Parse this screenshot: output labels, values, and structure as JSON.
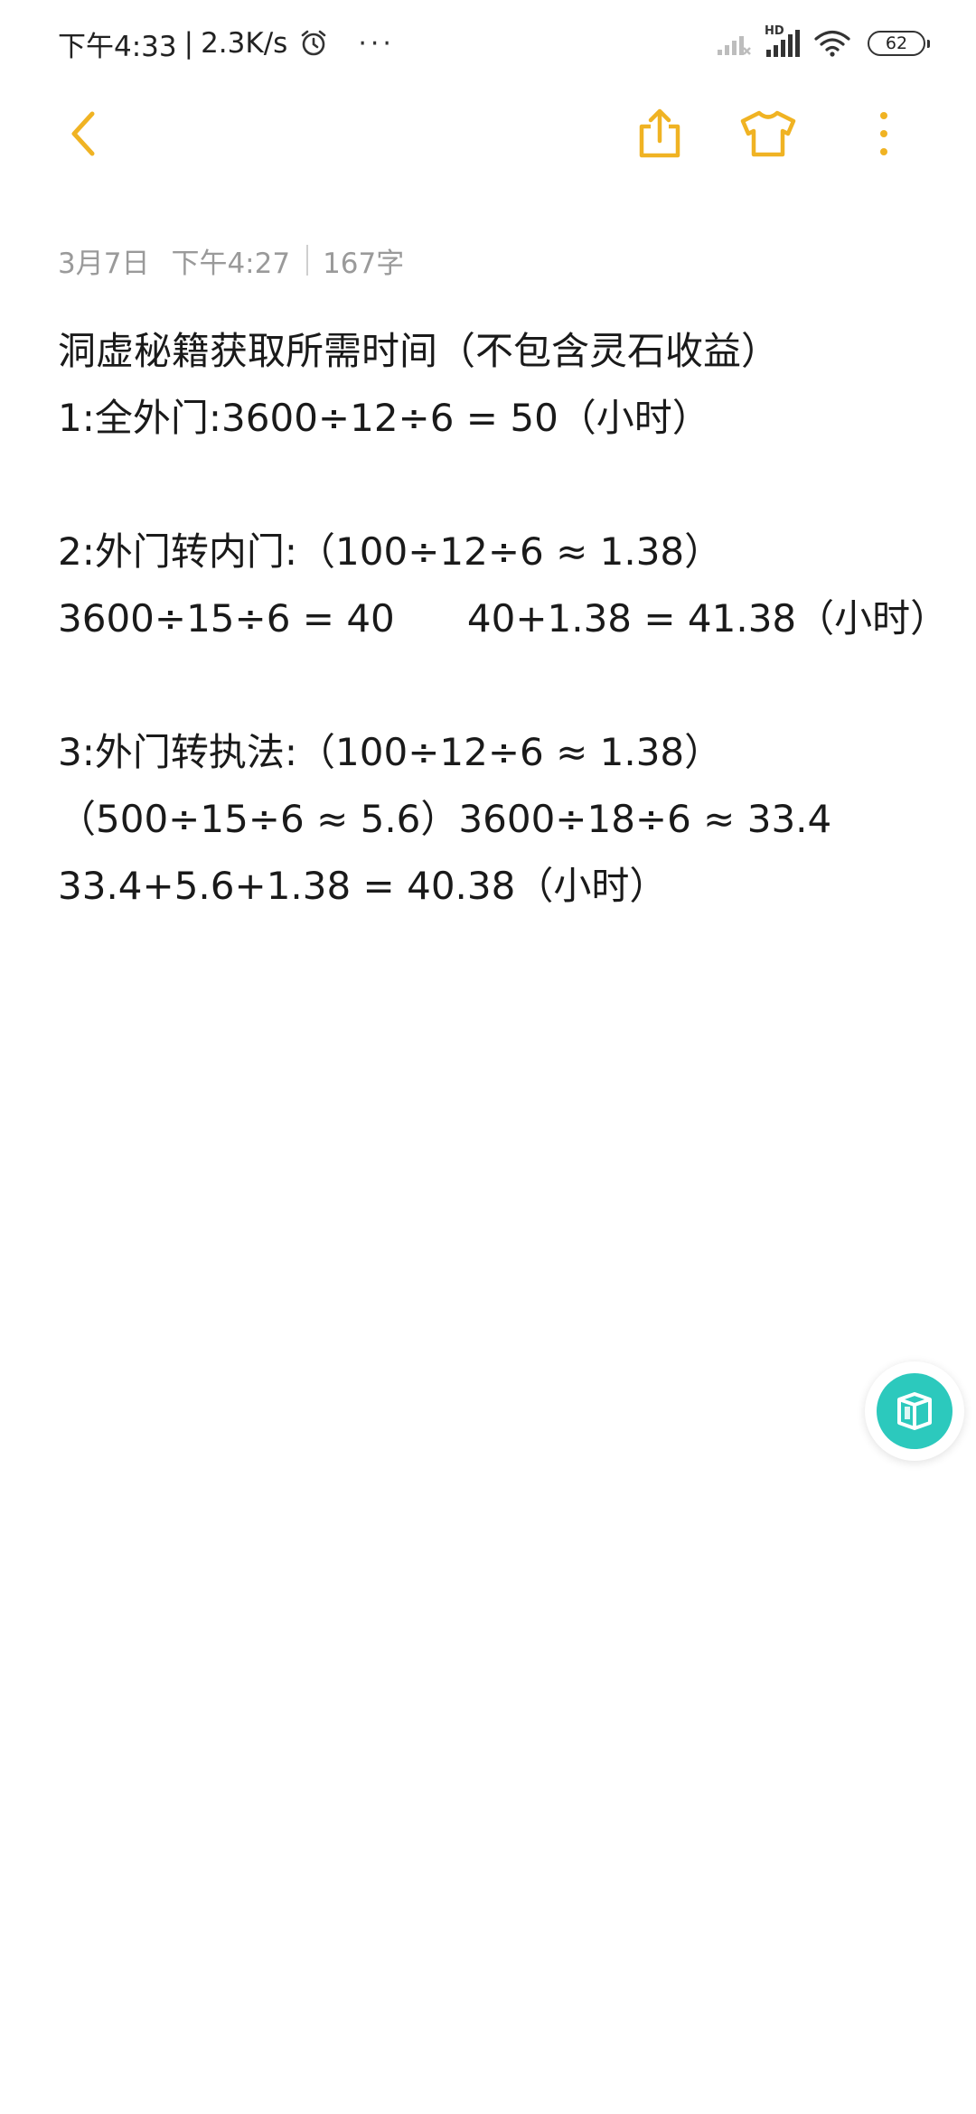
{
  "status_bar": {
    "time": "下午4:33",
    "separator": "|",
    "net_speed": "2.3K/s",
    "more_glyph": "···",
    "network_label": "HD",
    "battery_level": "62",
    "icons": [
      "alarm-icon",
      "signal-weak-icon",
      "signal-hd-icon",
      "wifi-icon",
      "battery-icon"
    ]
  },
  "toolbar": {
    "accent_color": "#f0b323",
    "icons": [
      "back-icon",
      "share-icon",
      "theme-shirt-icon",
      "more-vertical-icon"
    ]
  },
  "meta": {
    "date": "3月7日",
    "time": "下午4:27",
    "word_count": "167字"
  },
  "note": {
    "lines": [
      "洞虚秘籍获取所需时间（不包含灵石收益）",
      "1:全外门:3600÷12÷6 = 50（小时）",
      "",
      "2:外门转内门:（100÷12÷6 ≈ 1.38）",
      "3600÷15÷6 = 40      40+1.38 = 41.38（小时）",
      "",
      "3:外门转执法:（100÷12÷6 ≈ 1.38）",
      "（500÷15÷6 ≈ 5.6）3600÷18÷6 ≈ 33.4",
      "33.4+5.6+1.38 = 40.38（小时）"
    ]
  },
  "fab": {
    "icon": "mini-app-cube-icon",
    "color": "#2cc9bd"
  }
}
